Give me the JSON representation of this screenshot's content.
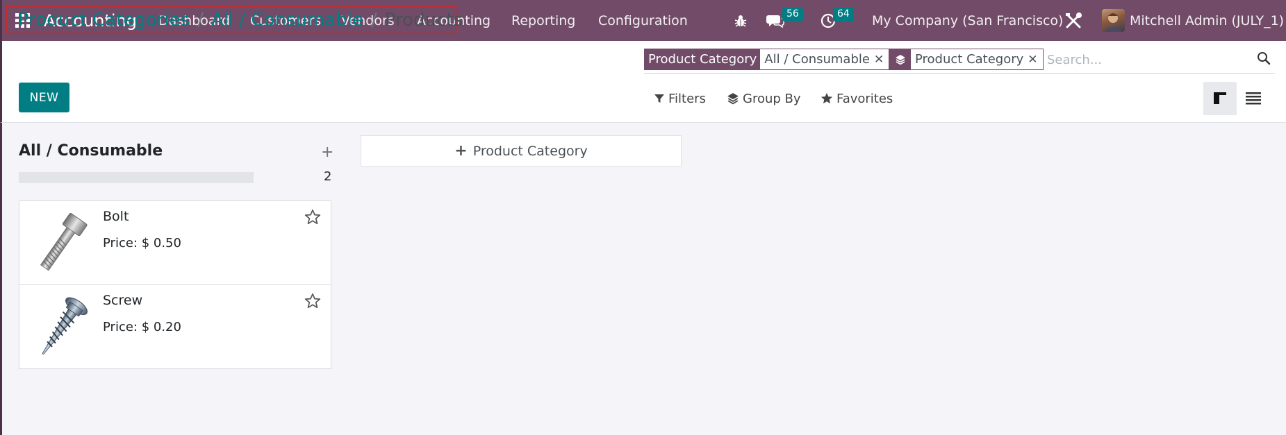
{
  "navbar": {
    "app_name": "Accounting",
    "menu": [
      "Dashboard",
      "Customers",
      "Vendors",
      "Accounting",
      "Reporting",
      "Configuration"
    ],
    "messages_count": "56",
    "activities_count": "64",
    "company": "My Company (San Francisco)",
    "user": "Mitchell Admin (JULY_1)",
    "icons": [
      "apps-grid-icon",
      "debug-bug-icon",
      "chat-icon",
      "clock-icon",
      "tools-icon",
      "avatar"
    ]
  },
  "breadcrumb": {
    "items": [
      "Product Categories",
      "All / Consumable"
    ],
    "separator": "/",
    "current": "Products"
  },
  "toolbar": {
    "new_label": "NEW",
    "filters_label": "Filters",
    "groupby_label": "Group By",
    "favorites_label": "Favorites"
  },
  "search": {
    "facet1_label": "Product Category",
    "facet1_value": "All / Consumable",
    "facet2_value": "Product Category",
    "placeholder": "Search..."
  },
  "kanban": {
    "group_title": "All / Consumable",
    "group_count": "2",
    "quick_create_label": "Product Category",
    "cards": [
      {
        "name": "Bolt",
        "price": "Price: $ 0.50"
      },
      {
        "name": "Screw",
        "price": "Price: $ 0.20"
      }
    ]
  },
  "colors": {
    "brand": "#714b67",
    "accent": "#017e84",
    "highlight_border": "#c32c2c"
  }
}
